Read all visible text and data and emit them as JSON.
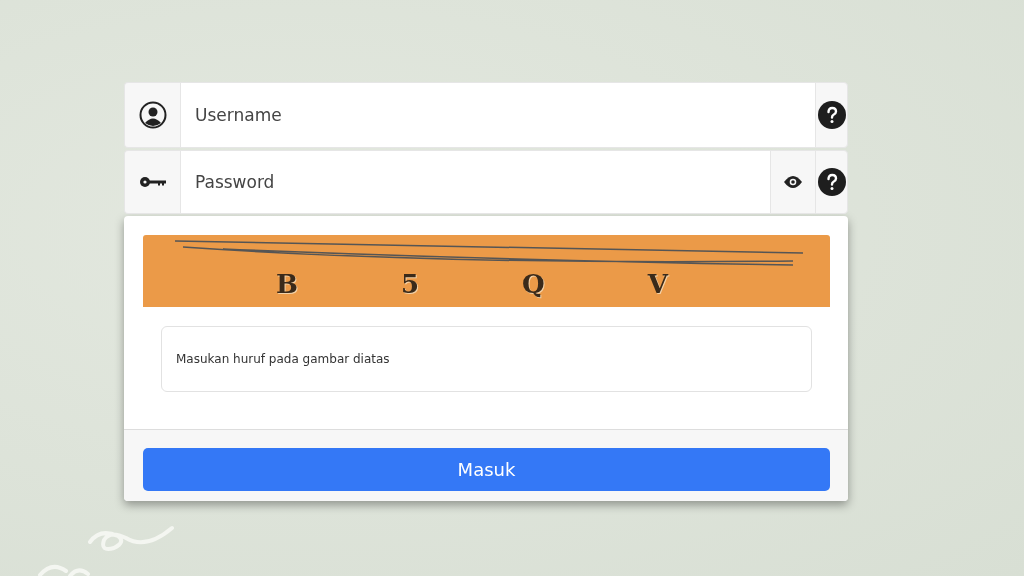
{
  "username": {
    "placeholder": "Username"
  },
  "password": {
    "placeholder": "Password"
  },
  "captcha": {
    "characters": [
      "B",
      "5",
      "Q",
      "V"
    ],
    "input": {
      "placeholder": "Masukan huruf pada gambar diatas"
    }
  },
  "submit": {
    "label": "Masuk"
  }
}
